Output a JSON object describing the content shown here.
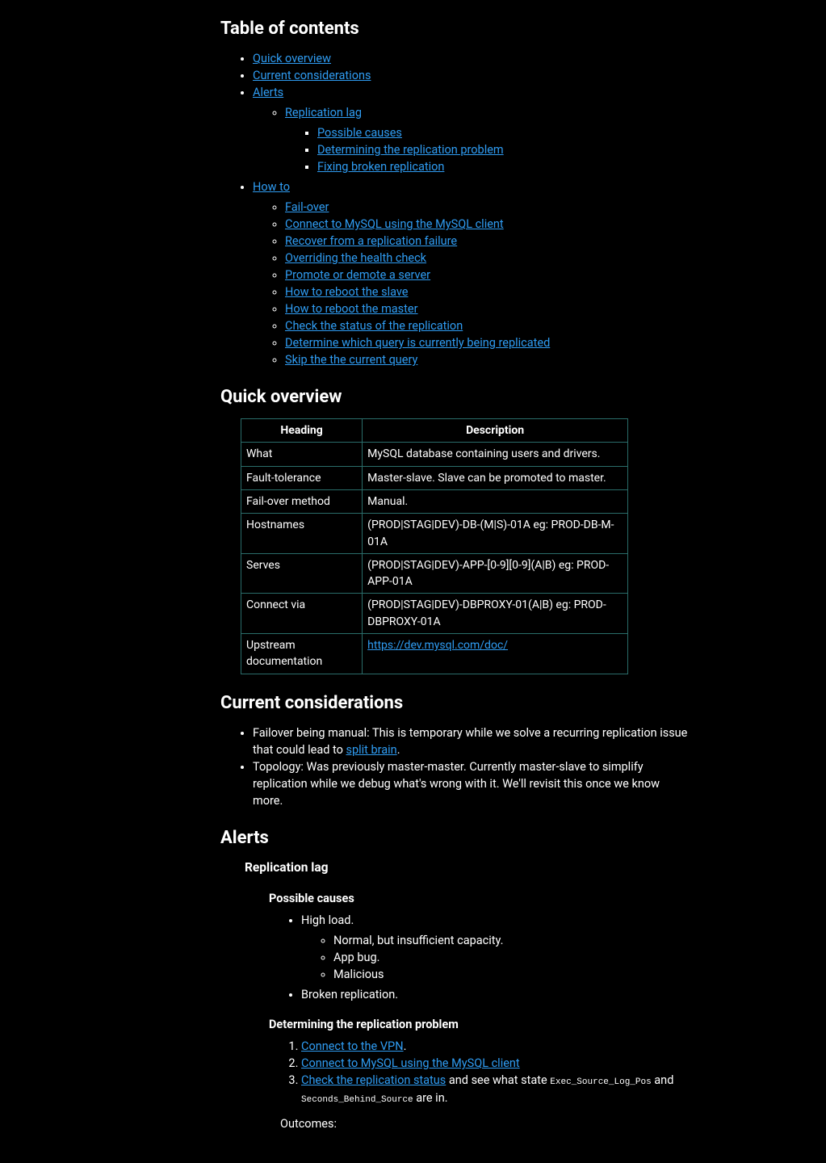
{
  "toc": {
    "title": "Table of contents",
    "items": {
      "quick": "Quick overview",
      "current": "Current considerations",
      "alerts": "Alerts",
      "replag": "Replication lag",
      "possible": "Possible causes",
      "determining": "Determining the replication problem",
      "fixing": "Fixing broken replication",
      "howto": "How to",
      "failover": "Fail-over",
      "connect": "Connect to MySQL using the MySQL client",
      "recover": "Recover from a replication failure",
      "override": "Overriding the health check",
      "promote": "Promote or demote a server",
      "rebootslave": "How to reboot the slave",
      "rebootmaster": "How to reboot the master",
      "checkstatus": "Check the status of the replication",
      "determine": "Determine which query is currently being replicated",
      "skip": "Skip the the current query"
    }
  },
  "quick": {
    "heading": "Quick overview",
    "th_heading": "Heading",
    "th_desc": "Description",
    "rows": {
      "what_h": "What",
      "what_d": "MySQL database containing users and drivers.",
      "fault_h": "Fault-tolerance",
      "fault_d": "Master-slave. Slave can be promoted to master.",
      "fom_h": "Fail-over method",
      "fom_d": "Manual.",
      "host_h": "Hostnames",
      "host_d": "(PROD|STAG|DEV)-DB-(M|S)-01A eg: PROD-DB-M-01A",
      "serves_h": "Serves",
      "serves_d": "(PROD|STAG|DEV)-APP-[0-9][0-9](A|B) eg: PROD-APP-01A",
      "connect_h": "Connect via",
      "connect_d": "(PROD|STAG|DEV)-DBPROXY-01(A|B) eg: PROD-DBPROXY-01A",
      "up_h": "Upstream documentation",
      "up_link": "https://dev.mysql.com/doc/"
    }
  },
  "current": {
    "heading": "Current considerations",
    "li1_a": "Failover being manual: This is temporary while we solve a recurring replication issue that could lead to ",
    "li1_link": "split brain",
    "li1_b": ".",
    "li2": "Topology: Was previously master-master. Currently master-slave to simplify replication while we debug what's wrong with it. We'll revisit this once we know more."
  },
  "alerts": {
    "heading": "Alerts",
    "replag": "Replication lag",
    "possible": {
      "heading": "Possible causes",
      "high": "High load.",
      "normal": "Normal, but insufficient capacity.",
      "appbug": "App bug.",
      "malicious": "Malicious",
      "broken": "Broken replication."
    },
    "determining": {
      "heading": "Determining the replication problem",
      "s1_link": "Connect to the VPN",
      "s1_tail": ".",
      "s2_link": "Connect to MySQL using the MySQL client",
      "s3_link": "Check the replication status",
      "s3_mid": " and see what state ",
      "s3_code1": "Exec_Source_Log_Pos",
      "s3_and": " and ",
      "s3_code2": "Seconds_Behind_Source",
      "s3_tail": " are in.",
      "outcomes": "Outcomes:"
    }
  }
}
